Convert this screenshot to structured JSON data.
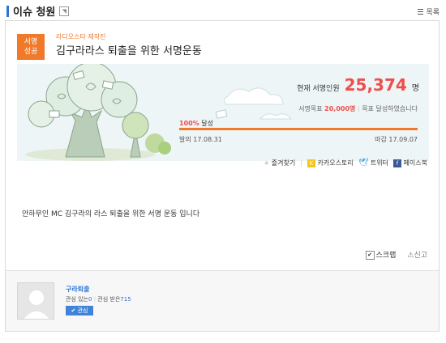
{
  "header": {
    "title": "이슈 청원",
    "rss_icon": "rss-icon",
    "list_label": "목록"
  },
  "petition": {
    "badge_line1": "서명",
    "badge_line2": "성공",
    "producer": "라디오스타 제작진",
    "title": "김구라라스 퇴출을 위한 서명운동",
    "signers_label": "현재 서명인원",
    "signers_count": "25,374",
    "signers_unit": "명",
    "goal_label": "서명목표",
    "goal_value": "20,000명",
    "goal_status": "목표 달성하였습니다",
    "progress_percent": "100%",
    "progress_text": "달성",
    "progress_fraction": 1.0,
    "start_label": "발의",
    "start_date": "17.08.31",
    "end_label": "마감",
    "end_date": "17.09.07",
    "description": "안하무인 MC 김구라의 라스 퇴출을 위한 서명 운동 입니다"
  },
  "share": {
    "bookmark": "즐겨찾기",
    "kakao": "카카오스토리",
    "twitter": "트위터",
    "facebook": "페이스북"
  },
  "actions": {
    "scrap": "스크랩",
    "report": "신고"
  },
  "author": {
    "name": "구라퇴출",
    "following_label": "관심 있는",
    "following_count": "0",
    "followers_label": "관심 받은",
    "followers_count": "715",
    "follow_button": "관심"
  },
  "colors": {
    "accent_orange": "#f07a2a",
    "count_red": "#ef4e4e",
    "link_blue": "#2d74d6"
  }
}
